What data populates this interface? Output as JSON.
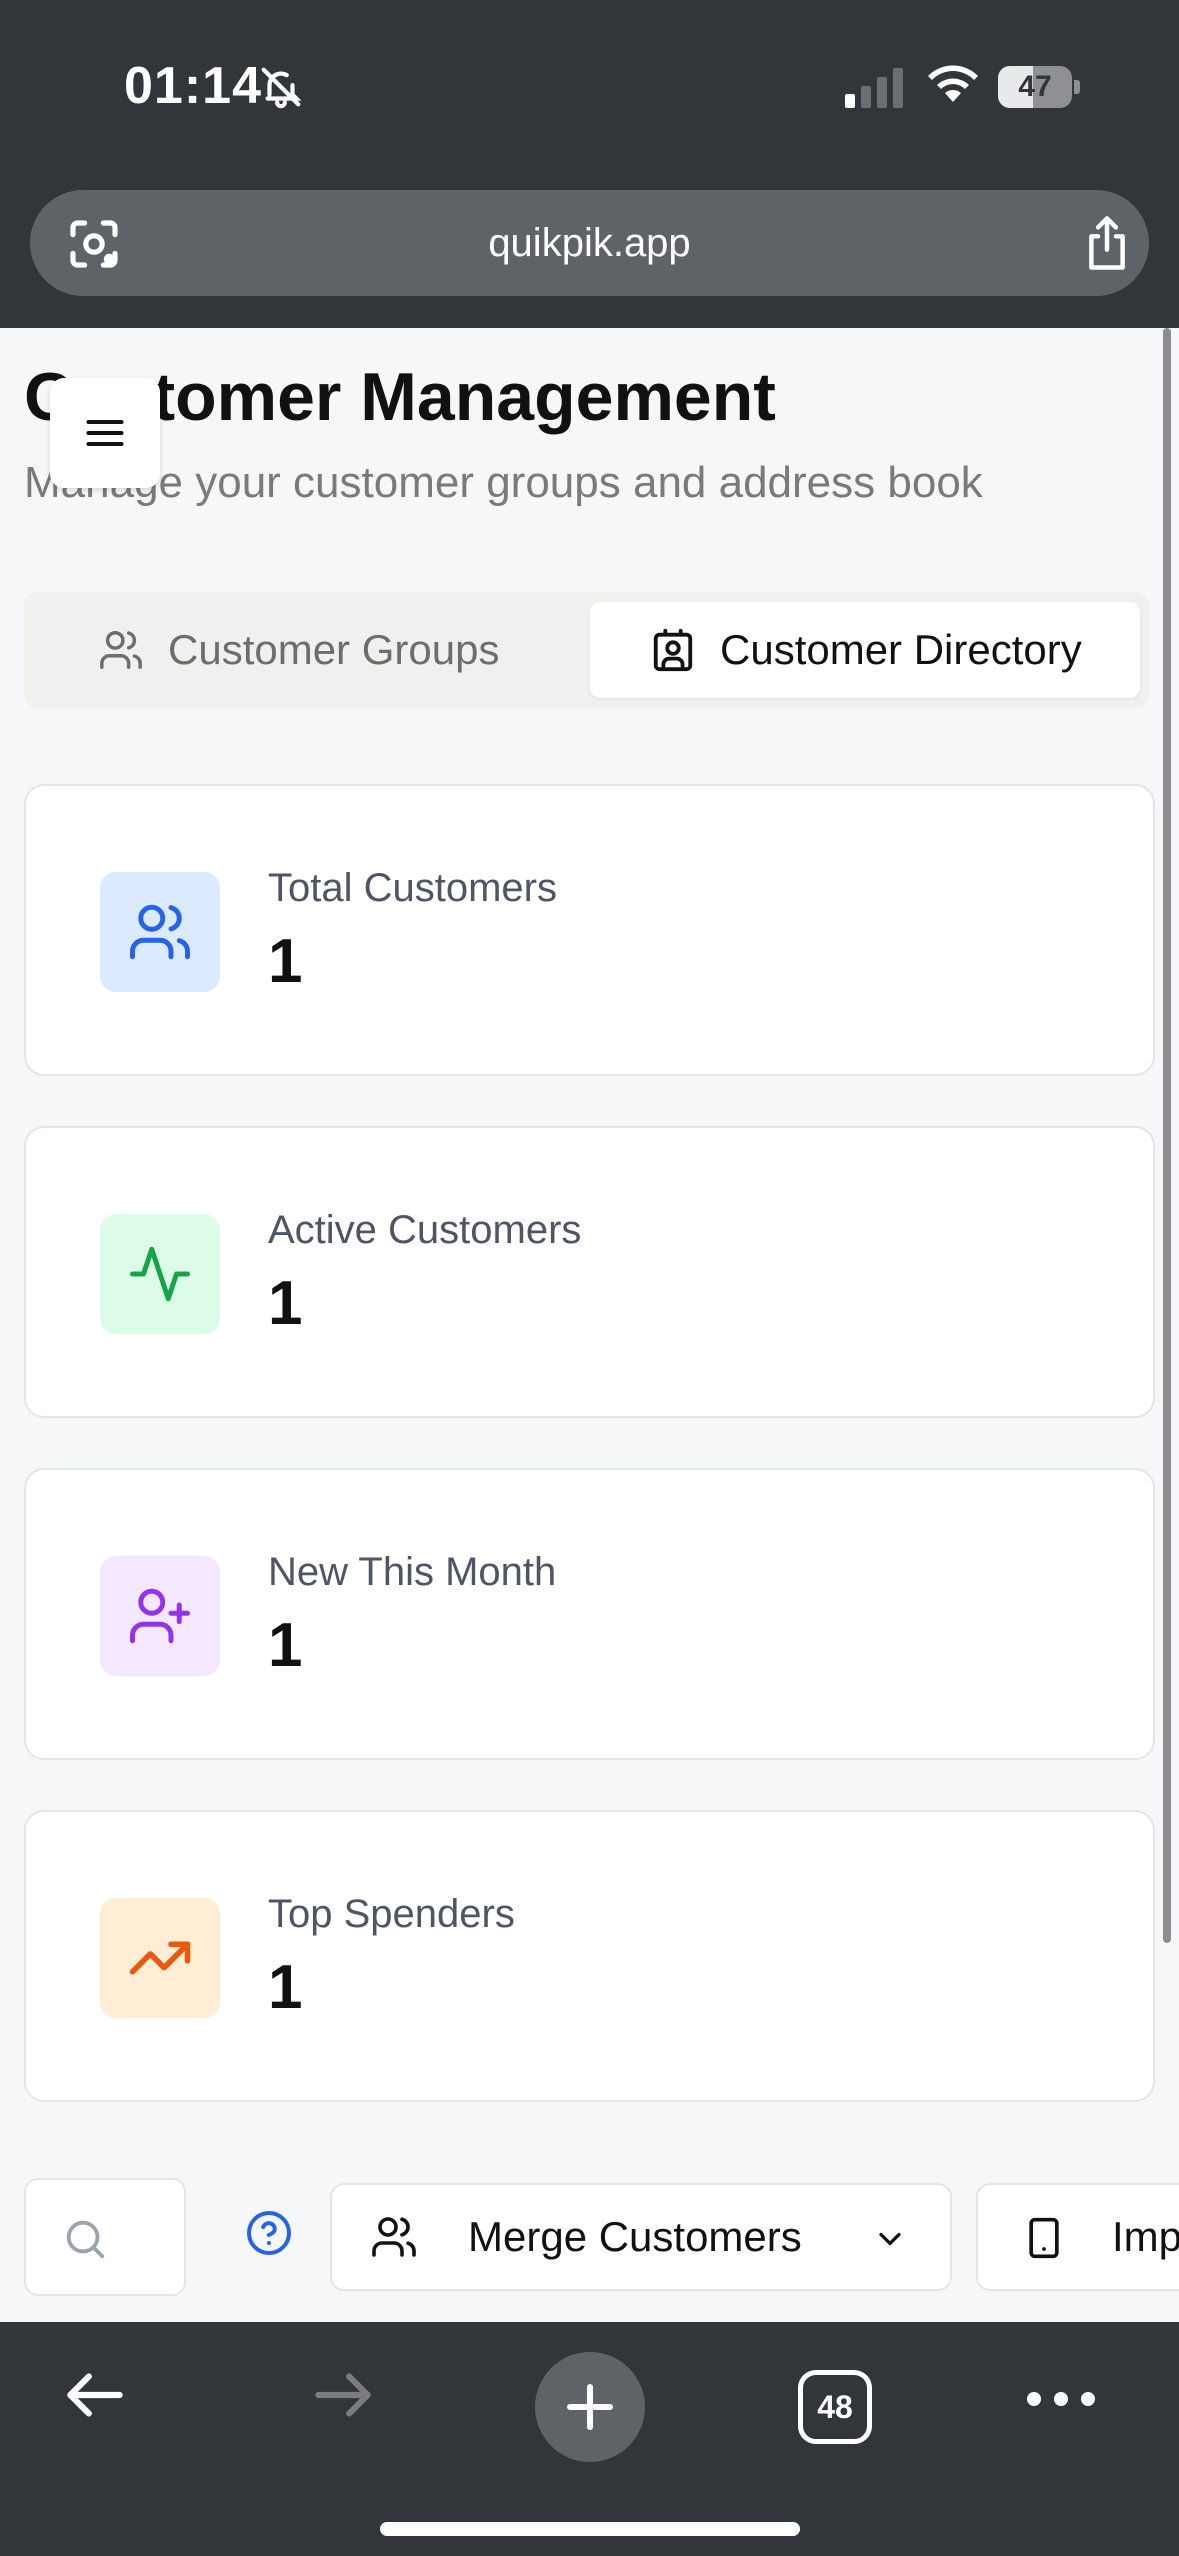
{
  "status_bar": {
    "time": "01:14",
    "battery": "47",
    "battery_level_percent": 47,
    "icons": [
      "bell-slash-icon",
      "cellular-signal-icon",
      "wifi-icon",
      "battery-icon"
    ]
  },
  "browser": {
    "url": "quikpik.app",
    "tab_count": "48",
    "icons": [
      "lens-icon",
      "share-icon",
      "back-arrow-icon",
      "forward-arrow-icon",
      "plus-icon",
      "more-icon"
    ]
  },
  "page": {
    "title": "Customer Management",
    "subtitle": "Manage your customer groups and address book"
  },
  "tabs": [
    {
      "label": "Customer Groups",
      "icon": "users-icon",
      "active": false
    },
    {
      "label": "Customer Directory",
      "icon": "contact-icon",
      "active": true
    }
  ],
  "stats": [
    {
      "label": "Total Customers",
      "value": "1",
      "icon": "users-icon",
      "color": "#2563eb",
      "bg": "#dbeafe"
    },
    {
      "label": "Active Customers",
      "value": "1",
      "icon": "activity-icon",
      "color": "#16a34a",
      "bg": "#dcfce7"
    },
    {
      "label": "New This Month",
      "value": "1",
      "icon": "user-plus-icon",
      "color": "#9333ea",
      "bg": "#f3e8ff"
    },
    {
      "label": "Top Spenders",
      "value": "1",
      "icon": "trending-up-icon",
      "color": "#ea580c",
      "bg": "#ffedd5"
    }
  ],
  "toolbar": {
    "merge_label": "Merge Customers",
    "import_label": "Imp"
  }
}
